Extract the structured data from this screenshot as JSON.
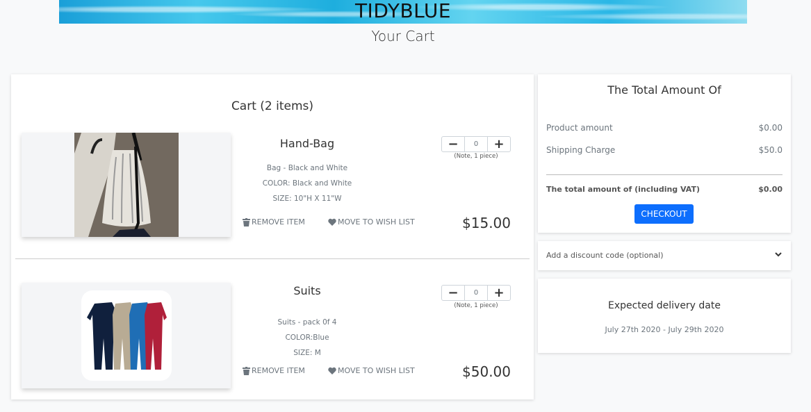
{
  "header": {
    "brand": "TIDYBLUE",
    "page_title": "Your Cart"
  },
  "cart": {
    "heading": "Cart (2 items)",
    "items": [
      {
        "name": "Hand-Bag",
        "description": "Bag - Black and White",
        "color": "COLOR: Black and White",
        "size": "SIZE: 10\"H X 11\"W",
        "quantity": "0",
        "note": "(Note, 1 piece)",
        "remove_label": "REMOVE ITEM",
        "wish_label": "MOVE TO WISH LIST",
        "price": "$15.00"
      },
      {
        "name": "Suits",
        "description": "Suits - pack 0f 4",
        "color": "COLOR:Blue",
        "size": "SIZE: M",
        "quantity": "0",
        "note": "(Note, 1 piece)",
        "remove_label": "REMOVE ITEM",
        "wish_label": "MOVE TO WISH LIST",
        "price": "$50.00"
      }
    ]
  },
  "summary": {
    "heading": "The Total Amount Of",
    "product_amount_label": "Product amount",
    "product_amount": "$0.00",
    "shipping_label": "Shipping Charge",
    "shipping": "$50.0",
    "total_label": "The total amount of (including VAT)",
    "total": "$0.00",
    "checkout_label": "CHECKOUT"
  },
  "discount": {
    "label": "Add a discount code (optional)"
  },
  "delivery": {
    "heading": "Expected delivery date",
    "range": "July 27th 2020 - July 29th 2020"
  },
  "colors": {
    "accent": "#0d6efd",
    "banner": "#2bb7e6"
  }
}
